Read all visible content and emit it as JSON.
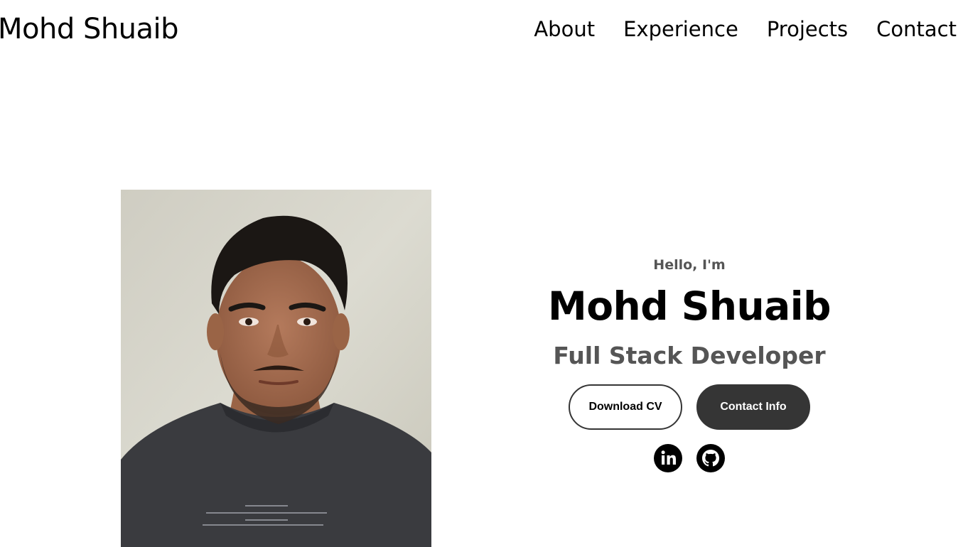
{
  "header": {
    "logo": "Mohd Shuaib",
    "nav": [
      {
        "label": "About"
      },
      {
        "label": "Experience"
      },
      {
        "label": "Projects"
      },
      {
        "label": "Contact"
      }
    ]
  },
  "hero": {
    "greeting": "Hello, I'm",
    "name": "Mohd Shuaib",
    "title": "Full Stack Developer",
    "buttons": {
      "download_cv": "Download CV",
      "contact_info": "Contact Info"
    },
    "socials": [
      {
        "icon": "linkedin-icon"
      },
      {
        "icon": "github-icon"
      }
    ]
  },
  "colors": {
    "dark": "#353535",
    "muted_text": "#555555"
  }
}
